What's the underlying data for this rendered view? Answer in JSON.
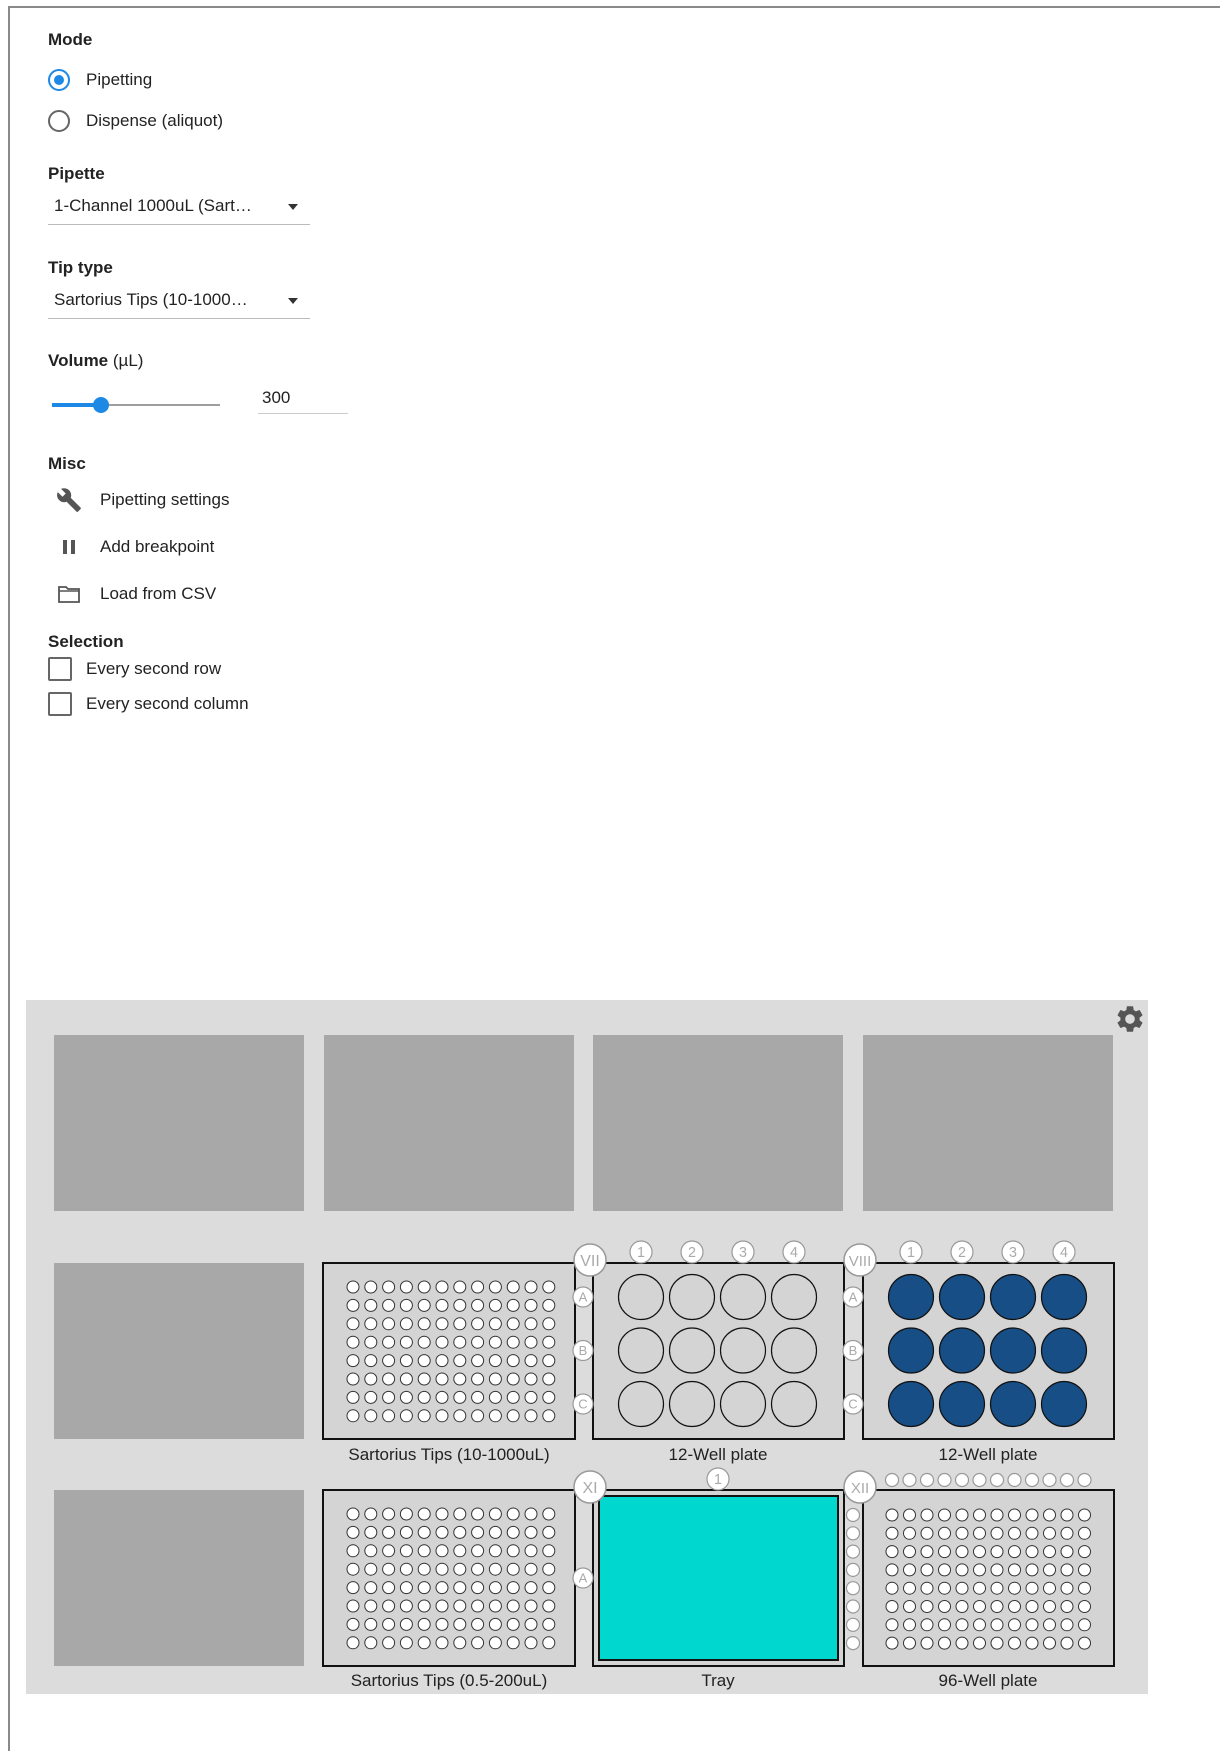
{
  "mode": {
    "title": "Mode",
    "options": [
      {
        "label": "Pipetting",
        "selected": true
      },
      {
        "label": "Dispense (aliquot)",
        "selected": false
      }
    ]
  },
  "pipette": {
    "title": "Pipette",
    "value": "1-Channel 1000uL (Sart…"
  },
  "tip_type": {
    "title": "Tip type",
    "value": "Sartorius Tips (10-1000…"
  },
  "volume": {
    "title": "Volume",
    "unit": "(µL)",
    "value": "300",
    "slider_fraction": 0.29
  },
  "misc": {
    "title": "Misc",
    "items": [
      {
        "label": "Pipetting settings",
        "icon": "wrench-icon"
      },
      {
        "label": "Add breakpoint",
        "icon": "pause-icon"
      },
      {
        "label": "Load from CSV",
        "icon": "folder-icon"
      }
    ]
  },
  "selection": {
    "title": "Selection",
    "options": [
      {
        "label": "Every second row",
        "checked": false
      },
      {
        "label": "Every second column",
        "checked": false
      }
    ]
  },
  "deck": {
    "settings_icon": "gear-icon",
    "slot_markers": [
      "VII",
      "VIII",
      "XI",
      "XII"
    ],
    "labware": [
      {
        "label": "Sartorius Tips (10-1000uL)",
        "type": "tiprack"
      },
      {
        "label": "12-Well plate",
        "type": "plate12",
        "state": "empty",
        "columns": [
          "1",
          "2",
          "3",
          "4"
        ],
        "rows": [
          "A",
          "B",
          "C"
        ]
      },
      {
        "label": "12-Well plate",
        "type": "plate12",
        "state": "filled",
        "columns": [
          "1",
          "2",
          "3",
          "4"
        ],
        "rows": [
          "A",
          "B",
          "C"
        ]
      },
      {
        "label": "Sartorius Tips (0.5-200uL)",
        "type": "tiprack"
      },
      {
        "label": "Tray",
        "type": "tray",
        "columns": [
          "1"
        ],
        "rows": [
          "A"
        ]
      },
      {
        "label": "96-Well plate",
        "type": "plate96"
      }
    ],
    "colors": {
      "filled_well": "#174e85",
      "tray_fill": "#00d8cf",
      "empty_slot": "#a8a8a8",
      "deck_bg": "#dcdcdc"
    }
  }
}
